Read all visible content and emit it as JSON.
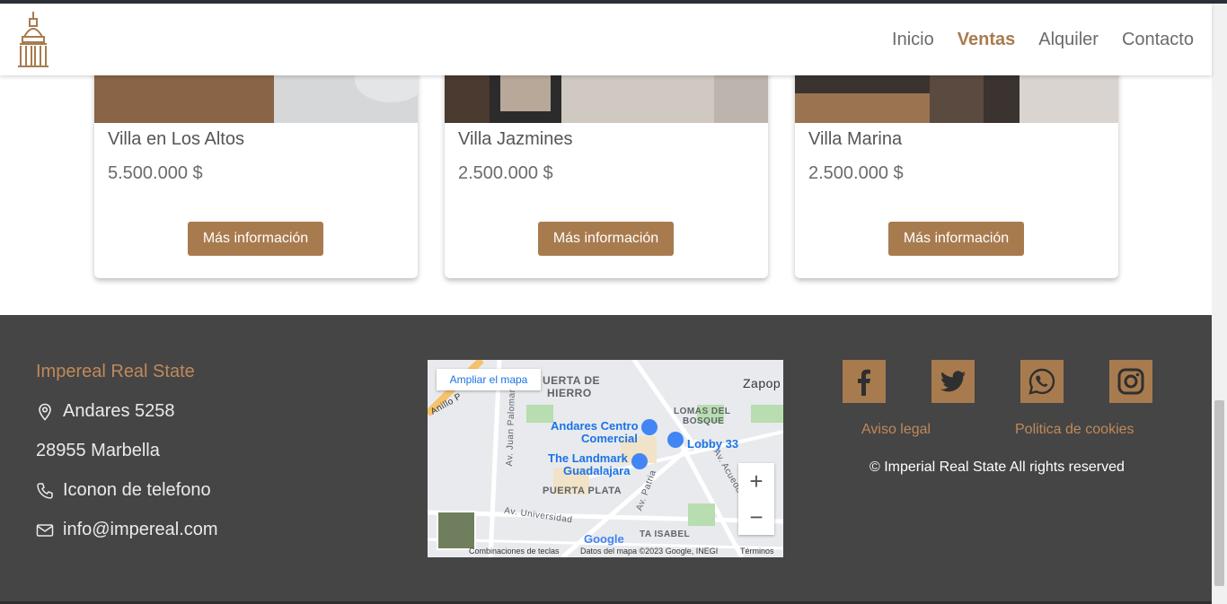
{
  "nav": {
    "items": [
      {
        "label": "Inicio"
      },
      {
        "label": "Ventas",
        "active": true
      },
      {
        "label": "Alquiler"
      },
      {
        "label": "Contacto"
      }
    ]
  },
  "listings": [
    {
      "title": "Villa en Los Altos",
      "price": "5.500.000 $",
      "button": "Más información"
    },
    {
      "title": "Villa Jazmines",
      "price": "2.500.000 $",
      "button": "Más información"
    },
    {
      "title": "Villa Marina",
      "price": "2.500.000 $",
      "button": "Más información"
    }
  ],
  "footer": {
    "brand": "Impereal Real State",
    "address": "Andares 5258",
    "city": "28955 Marbella",
    "phone": "Iconon de telefono",
    "email": "info@impereal.com",
    "map": {
      "enlarge": "Ampliar el mapa",
      "labels": {
        "puerta_hierro_1": "UERTA DE",
        "puerta_hierro_2": "HIERRO",
        "zapop": "Zapop",
        "lomas_1": "LOMAS DEL",
        "lomas_2": "BOSQUE",
        "puerta_plata": "PUERTA PLATA",
        "santa_isabel": "TA ISABEL",
        "av_universidad": "Av. Universidad",
        "av_patria": "Av. Patria",
        "av_acueducto": "Av. Acueducto",
        "av_juan_palomar": "Av. Juan Palomar",
        "anillo": "Anillo P"
      },
      "pois": {
        "andares_1": "Andares Centro",
        "andares_2": "Comercial",
        "lobby": "Lobby 33",
        "landmark_1": "The Landmark",
        "landmark_2": "Guadalajara"
      },
      "footer": {
        "shortcuts": "Combinaciones de teclas",
        "data": "Datos del mapa ©2023 Google, INEGI",
        "terms": "Términos"
      },
      "logo": "Google"
    },
    "links": {
      "legal": "Aviso legal",
      "cookies": "Politica de cookies"
    },
    "copyright": "© Imperial Real State All rights reserved",
    "social_icons": [
      "facebook-icon",
      "twitter-icon",
      "whatsapp-icon",
      "instagram-icon"
    ]
  },
  "colors": {
    "accent": "#a87b4f",
    "footer_bg": "#454545",
    "brand_text": "#c0895a"
  }
}
